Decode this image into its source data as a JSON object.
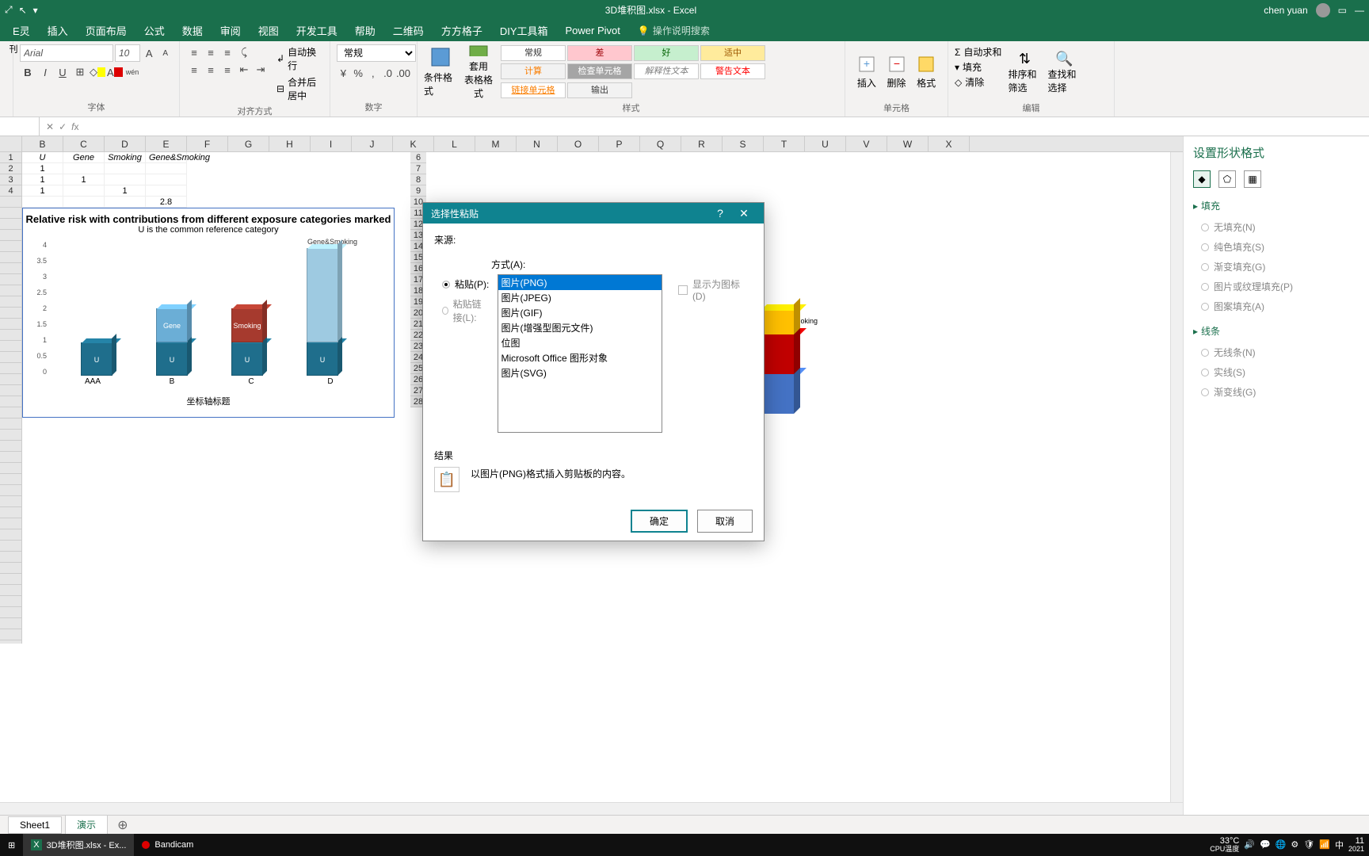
{
  "title_bar": {
    "filename": "3D堆积图.xlsx - Excel",
    "user": "chen yuan"
  },
  "ribbon_tabs": [
    "E灵",
    "插入",
    "页面布局",
    "公式",
    "数据",
    "审阅",
    "视图",
    "开发工具",
    "帮助",
    "二维码",
    "方方格子",
    "DIY工具箱",
    "Power Pivot"
  ],
  "search_hint": "操作说明搜索",
  "font": {
    "name": "Arial",
    "size": "10"
  },
  "align": {
    "wrap": "自动换行",
    "merge": "合并后居中"
  },
  "number": {
    "format": "常规"
  },
  "styles": {
    "cond": "条件格式",
    "table": "套用\n表格格式",
    "cells": [
      {
        "label": "常规",
        "bg": "#fff",
        "color": "#333"
      },
      {
        "label": "差",
        "bg": "#ffc7ce",
        "color": "#9c0006"
      },
      {
        "label": "好",
        "bg": "#c6efce",
        "color": "#006100"
      },
      {
        "label": "适中",
        "bg": "#ffeb9c",
        "color": "#9c5700"
      },
      {
        "label": "计算",
        "bg": "#f2f2f2",
        "color": "#fa7d00"
      },
      {
        "label": "检查单元格",
        "bg": "#a5a5a5",
        "color": "#fff"
      },
      {
        "label": "解释性文本",
        "bg": "#fff",
        "color": "#7f7f7f",
        "italic": true
      },
      {
        "label": "警告文本",
        "bg": "#fff",
        "color": "#ff0000"
      },
      {
        "label": "链接单元格",
        "bg": "#fff",
        "color": "#fa7d00",
        "underline": true
      },
      {
        "label": "输出",
        "bg": "#f2f2f2",
        "color": "#3f3f3f"
      }
    ]
  },
  "cells_group": {
    "insert": "插入",
    "delete": "删除",
    "format": "格式",
    "label": "单元格"
  },
  "edit_group": {
    "sum": "自动求和",
    "fill": "填充",
    "clear": "清除",
    "sort": "排序和筛选",
    "find": "查找和选择",
    "label": "编辑"
  },
  "group_labels": {
    "font": "字体",
    "align": "对齐方式",
    "number": "数字",
    "style": "样式"
  },
  "columns": [
    "B",
    "C",
    "D",
    "E",
    "F",
    "G",
    "H",
    "I",
    "J",
    "K",
    "L",
    "M",
    "N",
    "O",
    "P",
    "Q",
    "R",
    "S",
    "T",
    "U",
    "V",
    "W",
    "X"
  ],
  "rows": [
    "1",
    "2",
    "3",
    "4",
    "",
    "",
    "",
    "",
    "",
    "",
    "",
    "",
    "",
    "",
    "",
    "",
    "",
    "",
    "",
    "",
    "",
    "",
    "",
    "",
    "",
    "",
    "",
    "",
    "",
    "",
    "",
    "",
    "",
    "",
    "",
    "",
    "",
    "",
    ""
  ],
  "gap_rows": [
    "6",
    "7",
    "8",
    "9",
    "10",
    "11",
    "12",
    "13",
    "14",
    "15",
    "16",
    "17",
    "18",
    "19",
    "20",
    "21",
    "22",
    "23",
    "24",
    "25",
    "26",
    "27",
    "28"
  ],
  "table_headers": [
    "U",
    "Gene",
    "Smoking",
    "Gene&Smoking"
  ],
  "table_data": [
    [
      "1",
      "",
      "",
      ""
    ],
    [
      "1",
      "1",
      "",
      ""
    ],
    [
      "1",
      "",
      "1",
      ""
    ],
    [
      "",
      "",
      "",
      "2.8"
    ]
  ],
  "chart_data": {
    "type": "bar",
    "title": "Relative risk with contributions from different exposure categories marked",
    "subtitle": "U is the common reference category",
    "categories": [
      "AAA",
      "B",
      "C",
      "D"
    ],
    "series": [
      {
        "name": "U",
        "values": [
          1,
          1,
          1,
          1
        ],
        "color": "#1f6e8c"
      },
      {
        "name": "Gene",
        "values": [
          0,
          1,
          0,
          0
        ],
        "color": "#6baed6"
      },
      {
        "name": "Smoking",
        "values": [
          0,
          0,
          1,
          0
        ],
        "color": "#a63a2e"
      },
      {
        "name": "Gene&Smoking",
        "values": [
          0,
          0,
          0,
          2.8
        ],
        "color": "#9ecae1"
      }
    ],
    "ylim": [
      0,
      4
    ],
    "xlabel": "坐标轴标题",
    "yticks": [
      "0",
      "0.5",
      "1",
      "1.5",
      "2",
      "2.5",
      "3",
      "3.5",
      "4"
    ]
  },
  "shape_panel": {
    "title": "设置形状格式",
    "fill": "填充",
    "fill_opts": [
      "无填充(N)",
      "纯色填充(S)",
      "渐变填充(G)",
      "图片或纹理填充(P)",
      "图案填充(A)"
    ],
    "line": "线条",
    "line_opts": [
      "无线条(N)",
      "实线(S)",
      "渐变线(G)"
    ]
  },
  "dialog": {
    "title": "选择性粘贴",
    "source": "来源:",
    "method": "方式(A):",
    "paste": "粘贴(P):",
    "paste_link": "粘贴链接(L):",
    "show_icon": "显示为图标(D)",
    "options": [
      "图片(PNG)",
      "图片(JPEG)",
      "图片(GIF)",
      "图片(增强型图元文件)",
      "位图",
      "Microsoft Office 图形对象",
      "图片(SVG)"
    ],
    "result": "结果",
    "result_text": "以图片(PNG)格式插入剪贴板的内容。",
    "ok": "确定",
    "cancel": "取消",
    "help": "?"
  },
  "sheets": [
    "Sheet1",
    "演示"
  ],
  "taskbar": {
    "excel": "3D堆积图.xlsx - Ex...",
    "bandicam": "Bandicam",
    "temp": "33°C",
    "cpu": "CPU温度",
    "time": "11",
    "date": "2021"
  }
}
